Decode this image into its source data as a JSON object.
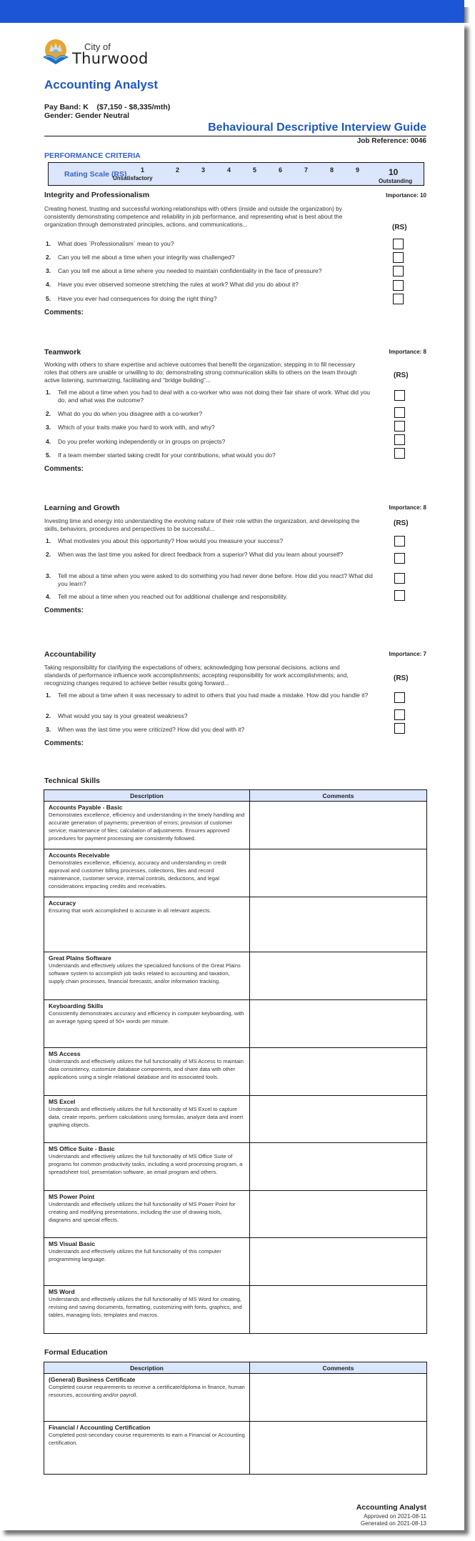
{
  "header": {
    "logo": {
      "icon": "city-logo-icon",
      "city_of": "City of",
      "name": "Thurwood"
    },
    "job_title": "Accounting Analyst",
    "pay_band_label": "Pay Band:",
    "pay_band": "K",
    "pay_range": "($7,150 - $8,335/mth)",
    "gender": "Gender: Gender Neutral",
    "guide_title": "Behavioural Descriptive Interview Guide",
    "job_reference": "Job Reference: 0046"
  },
  "performance": {
    "title": "PERFORMANCE CRITERIA",
    "rating_scale": {
      "label": "Rating Scale (RS)",
      "values": [
        "1",
        "2",
        "3",
        "4",
        "5",
        "6",
        "7",
        "8",
        "9",
        "10"
      ],
      "low_label": "Unsatisfactory",
      "high_label": "Outstanding"
    },
    "rs_label": "(RS)",
    "comments_label": "Comments:",
    "sections": [
      {
        "title": "Integrity and Professionalism",
        "importance": "Importance: 10",
        "description": "Creating honest, trusting and successful working relationships with others (inside and outside the organization) by consistently demonstrating competence and reliability in job performance, and representing what is best about the organization through demonstrated principles, actions, and communications...",
        "questions": [
          "What does `Professionalism` mean to you?",
          "Can you tell me about a time when your integrity was challenged?",
          "Can you tell me about a time where you needed to maintain confidentiality in the face of pressure?",
          "Have you ever observed someone stretching the rules at work? What did you do about it?",
          "Have you ever had consequences for doing the right thing?"
        ]
      },
      {
        "title": "Teamwork",
        "importance": "Importance: 8",
        "description": "Working with others to share expertise and achieve outcomes that benefit the organization; stepping in to fill necessary roles that others are unable or unwilling to do; demonstrating strong communication skills to others on the team through active listening, summarizing, facilitating and \"bridge building\"...",
        "questions": [
          "Tell me about a time when you had to deal with a co-worker who was not doing their fair share of work. What did you do, and what was the outcome?",
          "What do you do when you disagree with a co-worker?",
          "Which of your traits make you hard to work with, and why?",
          "Do you prefer working independently or in groups on projects?",
          "If a team member started taking credit for your contributions, what would you do?"
        ]
      },
      {
        "title": "Learning and Growth",
        "importance": "Importance: 8",
        "description": "Investing time and energy into understanding the evolving nature of their role within the organization, and developing the skills, behaviors, procedures and perspectives to be successful...",
        "questions": [
          "What motivates you about this opportunity? How would you measure your success?",
          "When was the last time you asked for direct feedback from a superior? What did you learn about yourself?",
          "Tell me about a time when you were asked to do something you had never done before. How did you react? What did you learn?",
          "Tell me about a time when you reached out for additional challenge and responsibility."
        ]
      },
      {
        "title": "Accountability",
        "importance": "Importance: 7",
        "description": "Taking responsibility for clarifying the expectations of others; acknowledging how personal decisions, actions and standards of performance influence work accomplishments; accepting responsibility for work accomplishments; and, recognizing changes required to achieve better results going forward...",
        "questions": [
          "Tell me about a time when it was necessary to admit to others that you had made a mistake. How did you handle it?",
          "What would you say is your greatest weakness?",
          "When was the last time you were criticized? How did you deal with it?"
        ]
      }
    ]
  },
  "technical_skills": {
    "title": "Technical Skills",
    "columns": [
      "Description",
      "Comments"
    ],
    "rows": [
      {
        "name": "Accounts Payable - Basic",
        "description": "Demonstrates excellence, efficiency and understanding in the timely handling and accurate generation of payments; prevention of errors; provision of customer service; maintenance of files; calculation of adjustments. Ensures approved procedures for payment processing are consistently followed.",
        "comment": ""
      },
      {
        "name": "Accounts Receivable",
        "description": "Demonstrates excellence, efficiency, accuracy and understanding in credit approval and customer billing processes, collections, files and record maintenance, customer service, internal controls, deductions, and legal considerations impacting credits and receivables.",
        "comment": ""
      },
      {
        "name": "Accuracy",
        "description": "Ensuring that work accomplished is accurate in all relevant aspects.",
        "comment": ""
      },
      {
        "name": "Great Plains Software",
        "description": "Understands and effectively utilizes the specialized functions of the Great Plains software system to accomplish job tasks related to accounting and taxation, supply chain processes, financial forecasts, and/or information tracking.",
        "comment": ""
      },
      {
        "name": "Keyboarding Skills",
        "description": "Consistently demonstrates accuracy and efficiency in computer keyboarding, with an average typing speed of 50+ words per minute.",
        "comment": ""
      },
      {
        "name": "MS Access",
        "description": "Understands and effectively utilizes the full functionality of MS Access to maintain data consistency, customize database components, and share data with other applications using a single relational database and its associated tools.",
        "comment": ""
      },
      {
        "name": "MS Excel",
        "description": "Understands and effectively utilizes the full functionality of MS Excel to capture data, create reports, perform calculations using formulas, analyze data and insert graphing objects.",
        "comment": ""
      },
      {
        "name": "MS Office Suite - Basic",
        "description": "Understands and effectively utilizes the full functionality of MS Office Suite of programs for common productivity tasks, including a word processing program, a spreadsheet tool, presentation software, an email program and others.",
        "comment": ""
      },
      {
        "name": "MS Power Point",
        "description": "Understands and effectively utilizes the full functionality of MS Power Point for creating and modifying presentations, including the use of drawing tools, diagrams and special effects.",
        "comment": ""
      },
      {
        "name": "MS Visual Basic",
        "description": "Understands and effectively utilizes the full functionality of this computer programming language.",
        "comment": ""
      },
      {
        "name": "MS Word",
        "description": "Understands and effectively utilizes the full functionality of MS Word for creating, revising and saving documents, formatting, customizing with fonts, graphics, and tables, managing lists, templates and macros.",
        "comment": ""
      }
    ]
  },
  "formal_education": {
    "title": "Formal Education",
    "columns": [
      "Description",
      "Comments"
    ],
    "rows": [
      {
        "name": "(General) Business Certificate",
        "description": "Completed course requirements to receive a certificate/diploma in finance, human resources, accounting and/or payroll.",
        "comment": ""
      },
      {
        "name": "Financial / Accounting Certification",
        "description": "Completed post-secondary course requirements to earn a Financial or Accounting certification.",
        "comment": ""
      }
    ]
  },
  "footer": {
    "title": "Accounting Analyst",
    "approved": "Approved on 2021-08-11",
    "generated": "Generated on 2021-08-13"
  },
  "colors": {
    "brand_blue": "#1c56d6",
    "heading_blue": "#1e57c9",
    "header_fill": "#dbe5fb"
  }
}
